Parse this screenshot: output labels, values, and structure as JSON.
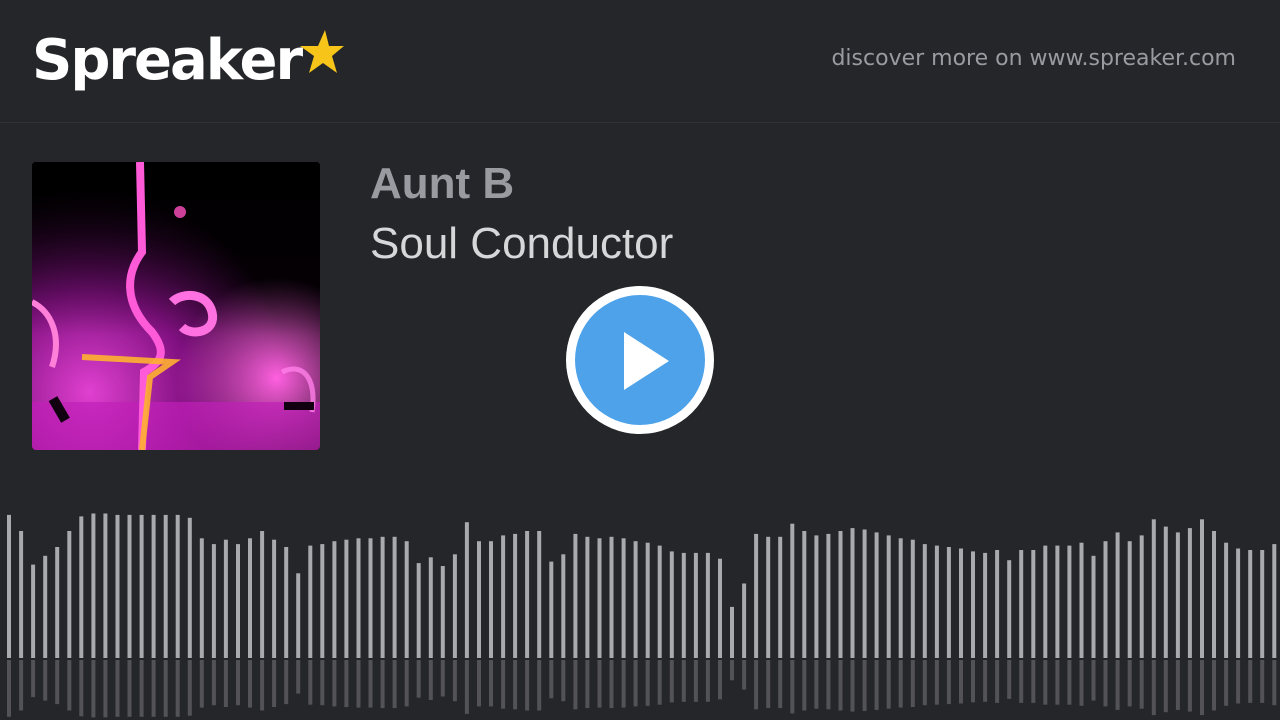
{
  "brand": {
    "logo_text": "Spreaker",
    "star_color": "#f7c51a",
    "link_text": "discover more on www.spreaker.com"
  },
  "episode": {
    "author": "Aunt B",
    "title": "Soul Conductor"
  },
  "player": {
    "play_color": "#4da2ea",
    "state": "paused"
  },
  "waveform": {
    "color": "#a9aaad",
    "levels": [
      0.98,
      0.87,
      0.64,
      0.7,
      0.76,
      0.87,
      0.97,
      0.99,
      0.99,
      0.98,
      0.98,
      0.98,
      0.98,
      0.98,
      0.98,
      0.96,
      0.82,
      0.78,
      0.81,
      0.78,
      0.82,
      0.87,
      0.81,
      0.76,
      0.58,
      0.77,
      0.78,
      0.8,
      0.81,
      0.82,
      0.82,
      0.83,
      0.83,
      0.8,
      0.65,
      0.69,
      0.63,
      0.71,
      0.93,
      0.8,
      0.8,
      0.84,
      0.85,
      0.87,
      0.87,
      0.66,
      0.71,
      0.85,
      0.83,
      0.82,
      0.83,
      0.82,
      0.8,
      0.79,
      0.77,
      0.73,
      0.72,
      0.72,
      0.72,
      0.68,
      0.35,
      0.51,
      0.85,
      0.83,
      0.83,
      0.92,
      0.87,
      0.84,
      0.85,
      0.87,
      0.89,
      0.88,
      0.86,
      0.84,
      0.82,
      0.81,
      0.78,
      0.77,
      0.76,
      0.75,
      0.73,
      0.72,
      0.74,
      0.67,
      0.74,
      0.74,
      0.77,
      0.77,
      0.77,
      0.79,
      0.7,
      0.8,
      0.86,
      0.8,
      0.84,
      0.95,
      0.9,
      0.86,
      0.89,
      0.95,
      0.87,
      0.79,
      0.75,
      0.74,
      0.74,
      0.78,
      0.79,
      0.8,
      0.62,
      0.51,
      0.45
    ]
  }
}
